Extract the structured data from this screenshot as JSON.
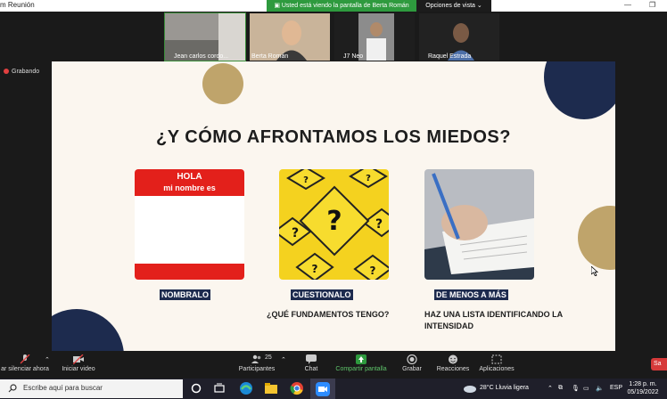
{
  "window": {
    "title": "m Reunión"
  },
  "banner": {
    "sharing_text": "Usted está viendo la pantalla de Berta Román",
    "view_options": "Opciones de vista"
  },
  "participants": [
    {
      "name": "Jean carlos cordo..."
    },
    {
      "name": "Berta Román"
    },
    {
      "name": "J7 Neo"
    },
    {
      "name": "Raquel Estrada"
    }
  ],
  "recording": {
    "label": "Grabando"
  },
  "slide": {
    "title": "¿Y CÓMO AFRONTAMOS LOS MIEDOS?",
    "name_tag": {
      "line1": "HOLA",
      "line2": "mi nombre es"
    },
    "colors": {
      "background": "#fbf6ef",
      "navy": "#1d2b4e",
      "gold": "#bfa46b",
      "red": "#e3201b",
      "yellow": "#f4d21f"
    },
    "items": [
      {
        "label": "NOMBRALO",
        "description": ""
      },
      {
        "label": "CUESTIONALO",
        "description": "¿QUÉ FUNDAMENTOS TENGO?"
      },
      {
        "label": "DE MENOS A MÁS",
        "description": "HAZ UNA LISTA IDENTIFICANDO LA INTENSIDAD"
      }
    ]
  },
  "toolbar": {
    "mute": "ar silenciar ahora",
    "video": "Iniciar video",
    "participants": "Participantes",
    "participants_count": "25",
    "chat": "Chat",
    "share": "Compartir pantalla",
    "record": "Grabar",
    "reactions": "Reacciones",
    "apps": "Aplicaciones",
    "end": "Sa"
  },
  "taskbar": {
    "search_placeholder": "Escribe aquí para buscar",
    "weather": "28°C  Lluvia ligera",
    "language": "ESP",
    "time": "1:28 p. m.",
    "date": "05/19/2022"
  }
}
